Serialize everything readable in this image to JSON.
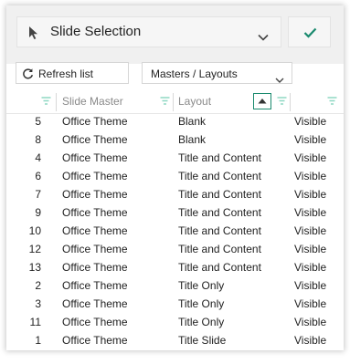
{
  "toolbar": {
    "selector_title": "Slide Selection",
    "pointer_icon": "pointer-arrow-icon",
    "chevron_icon": "chevron-down-icon",
    "confirm_icon": "checkmark-icon",
    "confirm_color": "#1a8a6e"
  },
  "controls": {
    "refresh_label": "Refresh list",
    "refresh_icon": "refresh-icon",
    "view_mode": "Masters / Layouts"
  },
  "table": {
    "columns": [
      "",
      "Slide Master",
      "Layout",
      ""
    ],
    "sort_column": "Layout",
    "sort_direction": "ascending",
    "accent_color": "#1a8a6e",
    "rows": [
      {
        "index": "5",
        "master": "Office Theme",
        "layout": "Blank",
        "status": "Visible"
      },
      {
        "index": "8",
        "master": "Office Theme",
        "layout": "Blank",
        "status": "Visible"
      },
      {
        "index": "4",
        "master": "Office Theme",
        "layout": "Title and Content",
        "status": "Visible"
      },
      {
        "index": "6",
        "master": "Office Theme",
        "layout": "Title and Content",
        "status": "Visible"
      },
      {
        "index": "7",
        "master": "Office Theme",
        "layout": "Title and Content",
        "status": "Visible"
      },
      {
        "index": "9",
        "master": "Office Theme",
        "layout": "Title and Content",
        "status": "Visible"
      },
      {
        "index": "10",
        "master": "Office Theme",
        "layout": "Title and Content",
        "status": "Visible"
      },
      {
        "index": "12",
        "master": "Office Theme",
        "layout": "Title and Content",
        "status": "Visible"
      },
      {
        "index": "13",
        "master": "Office Theme",
        "layout": "Title and Content",
        "status": "Visible"
      },
      {
        "index": "2",
        "master": "Office Theme",
        "layout": "Title Only",
        "status": "Visible"
      },
      {
        "index": "3",
        "master": "Office Theme",
        "layout": "Title Only",
        "status": "Visible"
      },
      {
        "index": "11",
        "master": "Office Theme",
        "layout": "Title Only",
        "status": "Visible"
      },
      {
        "index": "1",
        "master": "Office Theme",
        "layout": "Title Slide",
        "status": "Visible"
      }
    ]
  }
}
